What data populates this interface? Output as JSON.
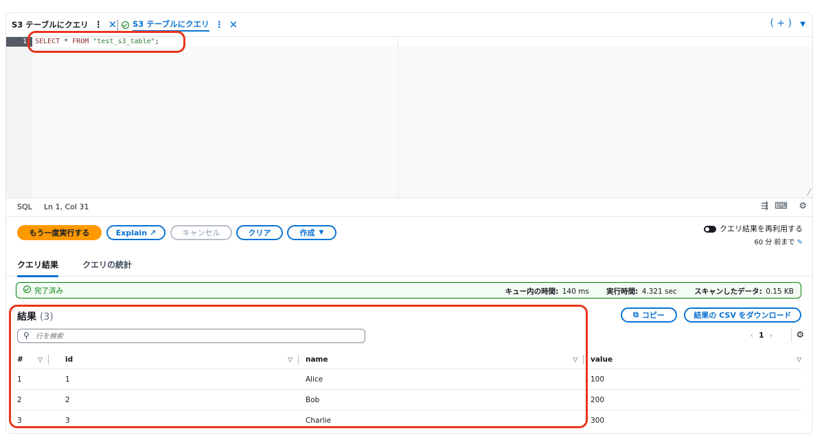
{
  "tabs": [
    {
      "label": "S3 テーブルにクエリ",
      "active": false
    },
    {
      "label": "S3 テーブルにクエリ",
      "active": true
    }
  ],
  "tab_icons": {
    "kebab": "⋮",
    "close": "✕",
    "add": "( + )",
    "caret": "▼"
  },
  "editor": {
    "line_number": "1",
    "sql": {
      "kw1": "SELECT",
      "star": " * ",
      "kw2": "FROM",
      "sp": " ",
      "table": "\"test_s3_table\"",
      "end": ";"
    }
  },
  "status": {
    "language": "SQL",
    "position": "Ln 1, Col 31"
  },
  "buttons": {
    "run_again": "もう一度実行する",
    "explain": "Explain",
    "cancel": "キャンセル",
    "clear": "クリア",
    "create": "作成"
  },
  "reuse": {
    "label": "クエリ結果を再利用する",
    "sub": "60 分 前まで"
  },
  "result_tabs": [
    "クエリ結果",
    "クエリの統計"
  ],
  "completion": {
    "status": "完了済み",
    "queue_label": "キュー内の時間:",
    "queue_value": "140 ms",
    "exec_label": "実行時間:",
    "exec_value": "4.321 sec",
    "scan_label": "スキャンしたデータ:",
    "scan_value": "0.15 KB"
  },
  "results": {
    "title": "結果",
    "count": "(3)",
    "copy": "コピー",
    "download": "結果の CSV をダウンロード",
    "search_placeholder": "行を検索",
    "page": "1",
    "columns": [
      "#",
      "id",
      "name",
      "value"
    ],
    "rows": [
      {
        "n": "1",
        "id": "1",
        "name": "Alice",
        "value": "100"
      },
      {
        "n": "2",
        "id": "2",
        "name": "Bob",
        "value": "200"
      },
      {
        "n": "3",
        "id": "3",
        "name": "Charlie",
        "value": "300"
      }
    ]
  },
  "colors": {
    "accent": "#0972d3",
    "primary": "#ff9900",
    "success": "#037f0c",
    "annotation": "#e8341c"
  }
}
